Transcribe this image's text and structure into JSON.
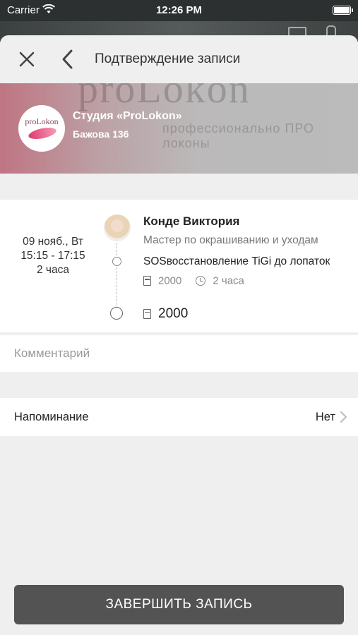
{
  "status_bar": {
    "carrier": "Carrier",
    "time": "12:26 PM"
  },
  "header": {
    "title": "Подтверждение записи"
  },
  "studio": {
    "name": "Студия «ProLokon»",
    "address": "Бажова 136",
    "logo_text": "proLokon",
    "banner_text": "proLokon",
    "banner_subtext": "профессионально ПРО локоны"
  },
  "appointment": {
    "date": "09 нояб., Вт",
    "time": "15:15 - 17:15",
    "duration": "2 часа",
    "master": {
      "name": "Конде Виктория",
      "role": "Мастер по окрашиванию и уходам"
    },
    "service": {
      "name": "SOSвосстановление TiGi до лопаток",
      "price": "2000",
      "duration": "2 часа"
    },
    "total": "2000"
  },
  "comment": {
    "placeholder": "Комментарий"
  },
  "reminder": {
    "label": "Напоминание",
    "value": "Нет"
  },
  "finish_button": {
    "label": "ЗАВЕРШИТЬ ЗАПИСЬ"
  },
  "colors": {
    "button": "#535353",
    "background": "#efefef",
    "status_bar": "#2d3030"
  },
  "icons": [
    "close-icon",
    "back-icon",
    "wifi-icon",
    "battery-icon",
    "price-icon",
    "clock-icon",
    "chevron-right-icon"
  ]
}
